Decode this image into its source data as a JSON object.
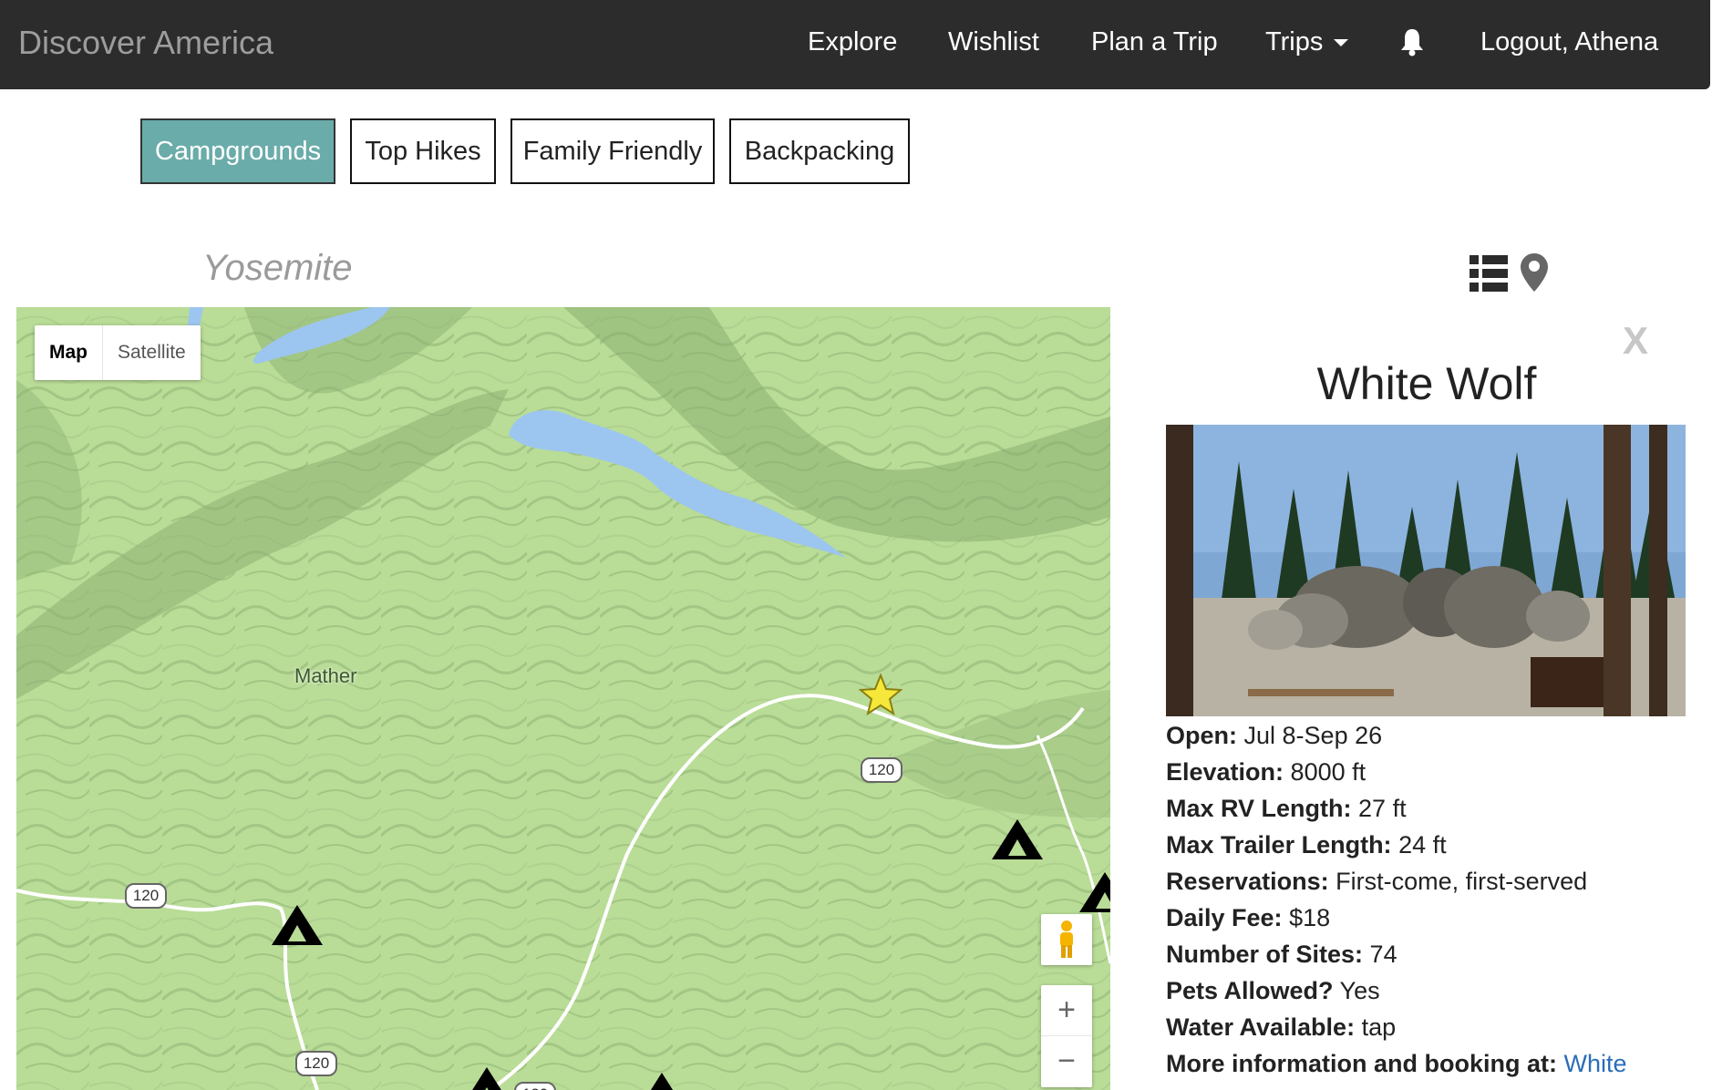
{
  "navbar": {
    "brand": "Discover America",
    "items": [
      {
        "label": "Explore"
      },
      {
        "label": "Wishlist"
      },
      {
        "label": "Plan a Trip"
      },
      {
        "label": "Trips"
      },
      {
        "label": "Logout, Athena"
      }
    ],
    "bell_icon": "bell-icon",
    "caret_icon": "caret-down-icon"
  },
  "filters": [
    {
      "label": "Campgrounds",
      "active": true
    },
    {
      "label": "Top Hikes",
      "active": false
    },
    {
      "label": "Family Friendly",
      "active": false
    },
    {
      "label": "Backpacking",
      "active": false
    }
  ],
  "park": {
    "name": "Yosemite"
  },
  "view_toggle": {
    "list_icon": "list-icon",
    "map_icon": "map-pin-icon"
  },
  "map": {
    "type_options": [
      "Map",
      "Satellite"
    ],
    "selected_type": "Map",
    "place_labels": [
      "Mather"
    ],
    "route_shields": [
      "120",
      "120",
      "120",
      "120"
    ],
    "controls": {
      "pegman": "pegman-icon",
      "zoom_in": "+",
      "zoom_out": "−"
    },
    "colors": {
      "terrain": "#b9dc97",
      "water": "#9cc6ef",
      "road": "#ffffff"
    }
  },
  "detail": {
    "close_label": "X",
    "title": "White Wolf",
    "fields": [
      {
        "label": "Open:",
        "value": "Jul 8-Sep 26"
      },
      {
        "label": "Elevation:",
        "value": "8000 ft"
      },
      {
        "label": "Max RV Length:",
        "value": "27 ft"
      },
      {
        "label": "Max Trailer Length:",
        "value": "24 ft"
      },
      {
        "label": "Reservations:",
        "value": "First-come, first-served"
      },
      {
        "label": "Daily Fee:",
        "value": "$18"
      },
      {
        "label": "Number of Sites:",
        "value": "74"
      },
      {
        "label": "Pets Allowed?",
        "value": "Yes"
      },
      {
        "label": "Water Available:",
        "value": "tap"
      }
    ],
    "more_info_label": "More information and booking at:",
    "more_info_link": "White"
  },
  "accent_color": "#6aacaa"
}
